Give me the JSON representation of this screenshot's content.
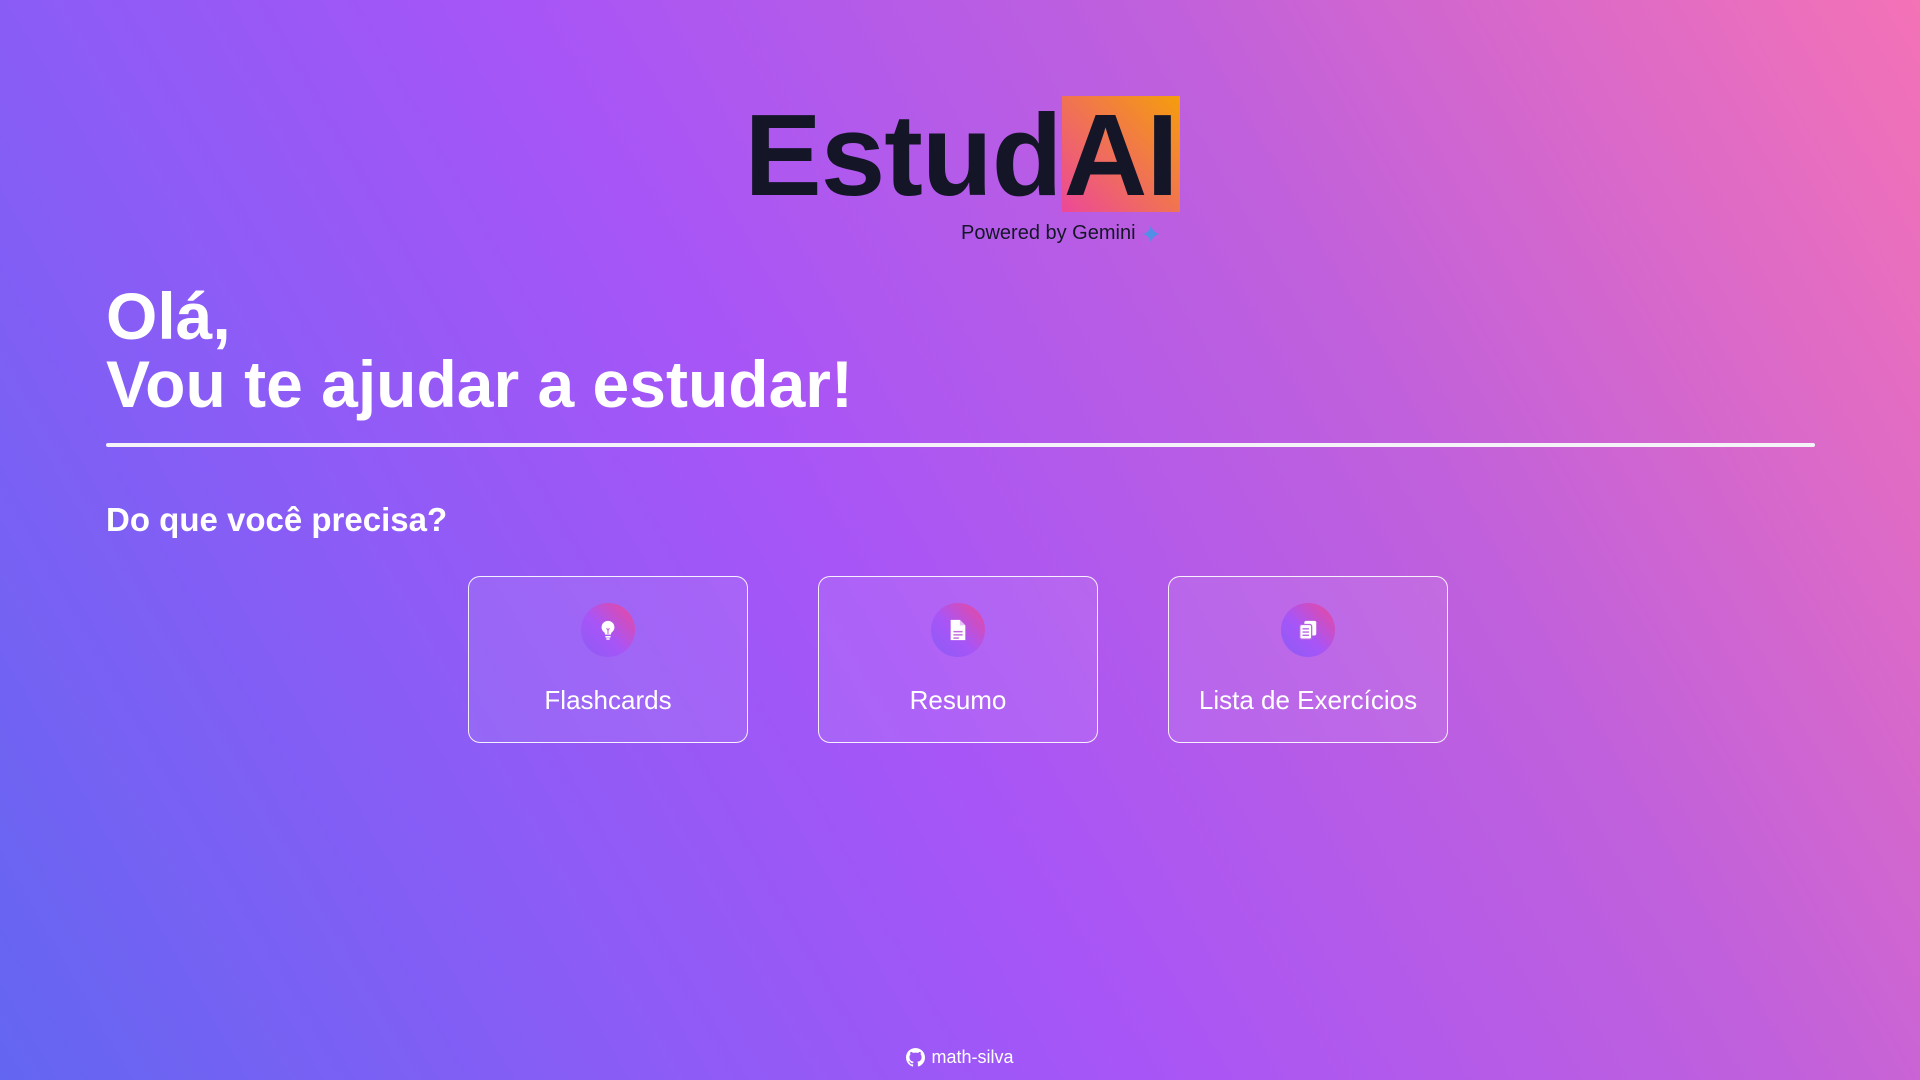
{
  "header": {
    "logo_prefix": "Estud",
    "logo_highlight": "AI",
    "powered_by": "Powered by Gemini"
  },
  "hero": {
    "greeting_line1": "Olá,",
    "greeting_line2": "Vou te ajudar a estudar!"
  },
  "main": {
    "question": "Do que você precisa?",
    "options": [
      {
        "label": "Flashcards",
        "icon": "lightbulb-icon"
      },
      {
        "label": "Resumo",
        "icon": "document-icon"
      },
      {
        "label": "Lista de Exercícios",
        "icon": "copy-document-icon"
      }
    ]
  },
  "footer": {
    "github_user": "math-silva",
    "icon": "github-icon"
  },
  "colors": {
    "logo_text": "#141628",
    "highlight_start": "#ec4899",
    "highlight_end": "#f59e0b",
    "gemini_star": "#4f8fe8"
  }
}
